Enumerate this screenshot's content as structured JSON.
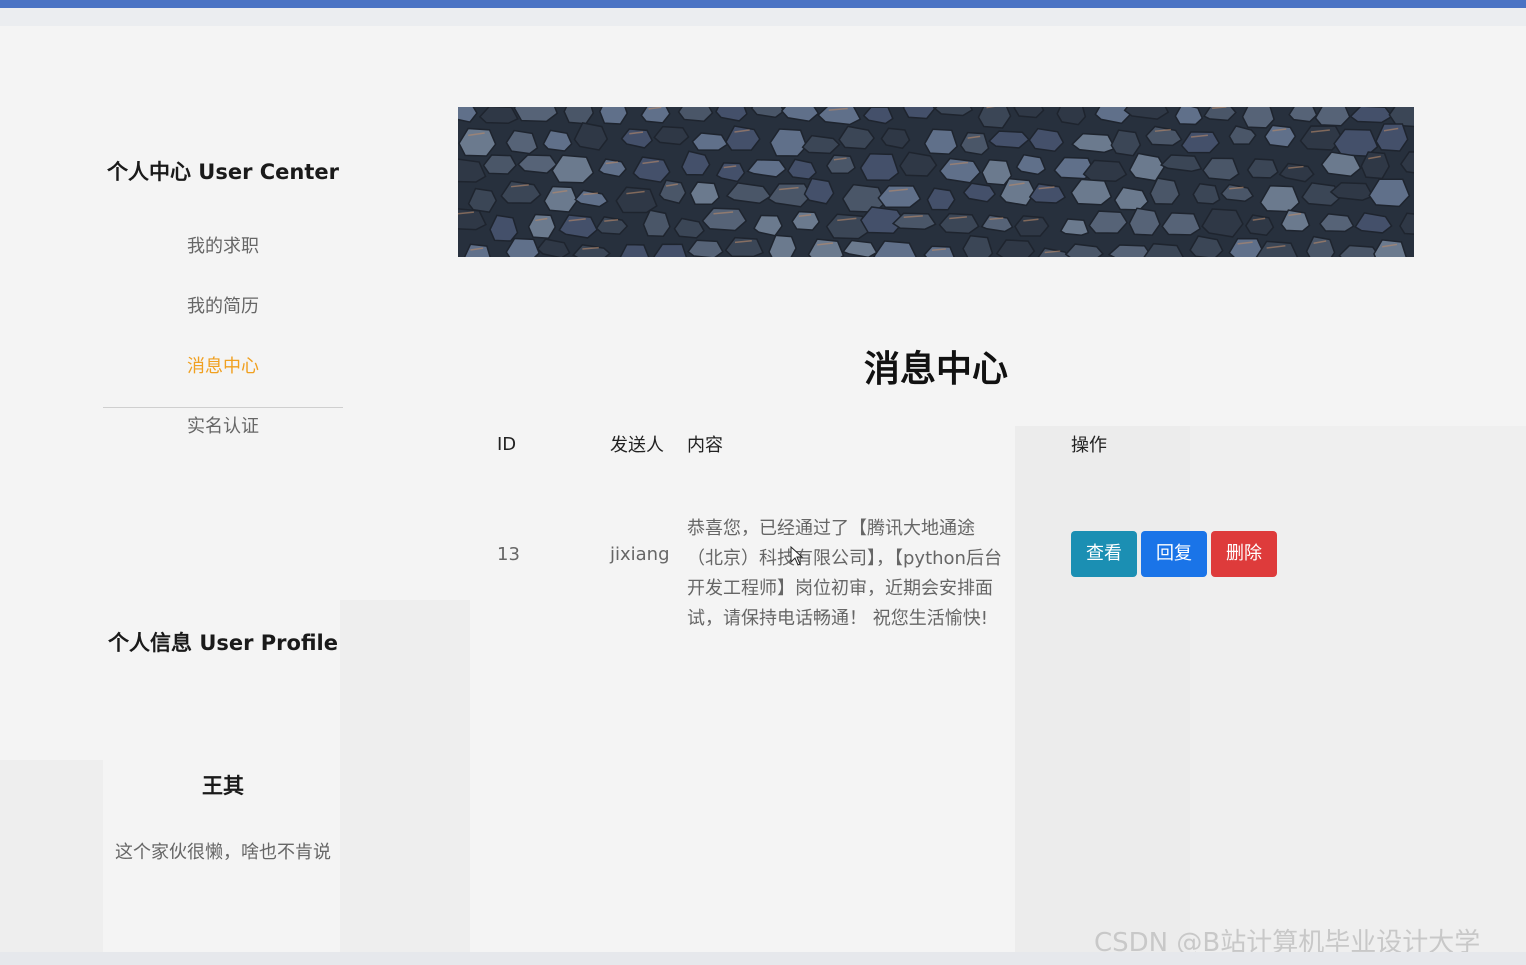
{
  "sidebar": {
    "user_center_title": "个人中心 User Center",
    "menu": [
      {
        "label": "我的求职"
      },
      {
        "label": "我的简历"
      },
      {
        "label": "消息中心"
      },
      {
        "label": "实名认证"
      }
    ],
    "user_profile_title": "个人信息 User Profile",
    "profile_name": "王其",
    "profile_signature": "这个家伙很懒，啥也不肯说"
  },
  "main": {
    "title": "消息中心",
    "table": {
      "headers": [
        "ID",
        "发送人",
        "内容",
        "操作"
      ],
      "rows": [
        {
          "id": "13",
          "sender": "jixiang",
          "content": "恭喜您，已经通过了【腾讯大地通途（北京）科技有限公司】，【python后台开发工程师】岗位初审，近期会安排面试，请保持电话畅通！ 祝您生活愉快!",
          "actions": {
            "view": "查看",
            "reply": "回复",
            "delete": "删除"
          }
        }
      ]
    }
  },
  "watermark": "CSDN @B站计算机毕业设计大学",
  "colors": {
    "top_bar": "#4a73c4",
    "active_menu": "#f0a020",
    "btn_view": "#1b8fb3",
    "btn_reply": "#1a74e8",
    "btn_delete": "#de3b3b"
  }
}
